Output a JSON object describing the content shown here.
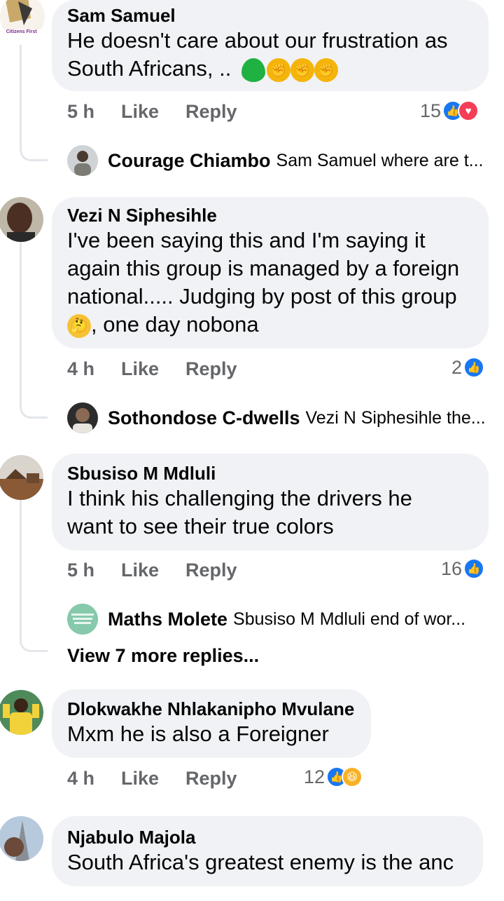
{
  "comments": [
    {
      "author": "Sam Samuel",
      "text_line1": "He doesn't care about our frustration as",
      "text_line2": "South Africans, ..",
      "time": "5 h",
      "like_label": "Like",
      "reply_label": "Reply",
      "reaction_count": "15",
      "reactions": [
        "like",
        "love"
      ],
      "avatar_caption": "A Citizens First",
      "reply": {
        "name": "Courage Chiambo",
        "snippet": "Sam Samuel where are t..."
      }
    },
    {
      "author": "Vezi N Siphesihle",
      "text_line1": "I've been saying this and I'm saying it",
      "text_line2": "again this group is managed by a foreign",
      "text_line3": "national..... Judging by post of this group",
      "text_line4": ", one day nobona",
      "time": "4 h",
      "like_label": "Like",
      "reply_label": "Reply",
      "reaction_count": "2",
      "reactions": [
        "like"
      ],
      "reply": {
        "name": "Sothondose C-dwells",
        "snippet": "Vezi N Siphesihle the..."
      }
    },
    {
      "author": "Sbusiso M Mdluli",
      "text_line1": "I think his challenging the drivers he",
      "text_line2": "want to see their true colors",
      "time": "5 h",
      "like_label": "Like",
      "reply_label": "Reply",
      "reaction_count": "16",
      "reactions": [
        "like"
      ],
      "reply": {
        "name": "Maths Molete",
        "snippet": "Sbusiso M Mdluli end of wor..."
      },
      "view_more": "View 7 more replies..."
    },
    {
      "author": "Dlokwakhe Nhlakanipho Mvulane",
      "text_line1": "Mxm he is also a Foreigner",
      "time": "4 h",
      "like_label": "Like",
      "reply_label": "Reply",
      "reaction_count": "12",
      "reactions": [
        "like",
        "haha"
      ]
    },
    {
      "author": "Njabulo Majola",
      "text_line1": "South Africa's greatest enemy is the anc"
    }
  ],
  "colors": {
    "bubble_bg": "#f0f2f5",
    "meta_text": "#65676b",
    "like_blue": "#1877f2",
    "love_red": "#f33e58",
    "thread_line": "#e4e6eb"
  },
  "icons": [
    "green-heart-icon",
    "fist-icon",
    "thinking-face-icon",
    "like-reaction-icon",
    "love-reaction-icon",
    "haha-reaction-icon"
  ]
}
